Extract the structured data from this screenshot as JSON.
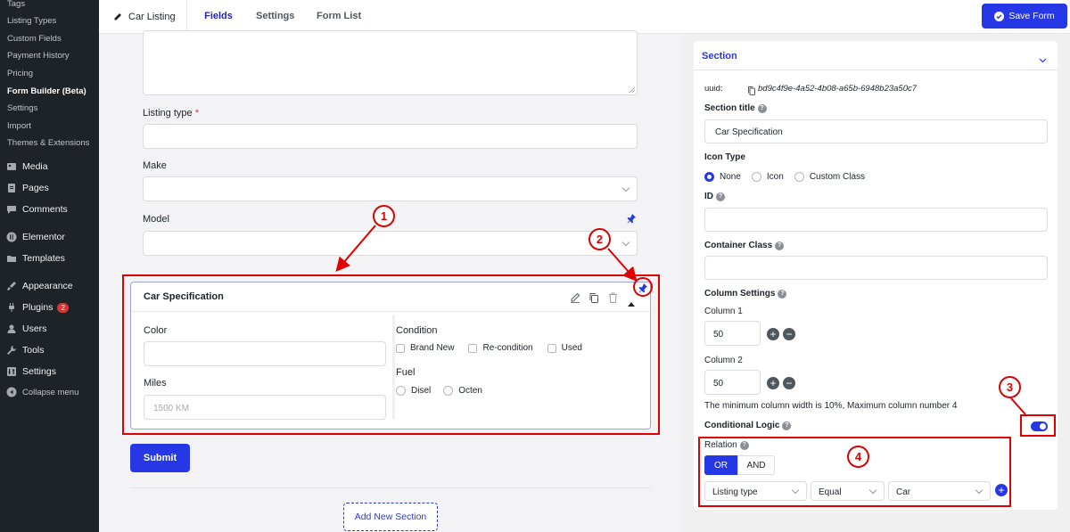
{
  "sidebar": {
    "submenu": [
      {
        "label": "Tags",
        "active": false
      },
      {
        "label": "Listing Types",
        "active": false
      },
      {
        "label": "Custom Fields",
        "active": false
      },
      {
        "label": "Payment History",
        "active": false
      },
      {
        "label": "Pricing",
        "active": false
      },
      {
        "label": "Form Builder (Beta)",
        "active": true
      },
      {
        "label": "Settings",
        "active": false
      },
      {
        "label": "Import",
        "active": false
      },
      {
        "label": "Themes & Extensions",
        "active": false
      }
    ],
    "menu": [
      {
        "label": "Media",
        "icon": "media-icon"
      },
      {
        "label": "Pages",
        "icon": "pages-icon"
      },
      {
        "label": "Comments",
        "icon": "comments-icon"
      },
      {
        "label": "Elementor",
        "icon": "elementor-icon"
      },
      {
        "label": "Templates",
        "icon": "templates-icon"
      },
      {
        "label": "Appearance",
        "icon": "appearance-icon"
      },
      {
        "label": "Plugins",
        "icon": "plugins-icon",
        "badge": "2"
      },
      {
        "label": "Users",
        "icon": "users-icon"
      },
      {
        "label": "Tools",
        "icon": "tools-icon"
      },
      {
        "label": "Settings",
        "icon": "settings-icon"
      },
      {
        "label": "Collapse menu",
        "icon": "collapse-icon"
      }
    ]
  },
  "topbar": {
    "form_name": "Car Listing",
    "tabs": [
      "Fields",
      "Settings",
      "Form List"
    ],
    "active_tab": "Fields",
    "save_label": "Save Form"
  },
  "form": {
    "listing_type_label": "Listing type",
    "required_mark": "*",
    "make_label": "Make",
    "model_label": "Model",
    "section": {
      "title": "Car Specification",
      "color_label": "Color",
      "miles_label": "Miles",
      "miles_placeholder": "1500 KM",
      "condition_label": "Condition",
      "condition_options": [
        "Brand New",
        "Re-condition",
        "Used"
      ],
      "fuel_label": "Fuel",
      "fuel_options": [
        "Disel",
        "Octen"
      ]
    },
    "submit_label": "Submit",
    "add_section_label": "Add New Section"
  },
  "panel": {
    "header": "Section",
    "uuid_label": "uuid:",
    "uuid_value": "bd9c4f9e-4a52-4b08-a65b-6948b23a50c7",
    "section_title_label": "Section title",
    "section_title_value": "Car Specification",
    "icon_type_label": "Icon Type",
    "icon_type_options": [
      "None",
      "Icon",
      "Custom Class"
    ],
    "icon_type_selected": "None",
    "id_label": "ID",
    "container_class_label": "Container Class",
    "column_settings_label": "Column Settings",
    "column1_label": "Column 1",
    "column1_value": "50",
    "column2_label": "Column 2",
    "column2_value": "50",
    "column_note": "The minimum column width is 10%, Maximum column number 4",
    "conditional_logic_label": "Conditional Logic",
    "conditional_logic_on": true,
    "relation_label": "Relation",
    "relation_or": "OR",
    "relation_and": "AND",
    "relation_selected": "OR",
    "rule_field": "Listing type",
    "rule_operator": "Equal",
    "rule_value": "Car"
  },
  "annotations": [
    "1",
    "2",
    "3",
    "4"
  ],
  "colors": {
    "accent": "#2638e6",
    "annotation": "#e00000",
    "sidebar": "#1d2327"
  }
}
